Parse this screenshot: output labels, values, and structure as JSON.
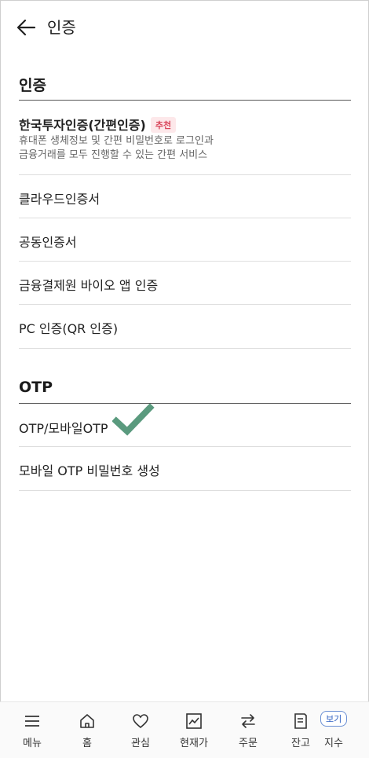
{
  "header": {
    "title": "인증"
  },
  "sections": {
    "auth": {
      "title": "인증",
      "items": [
        {
          "label": "한국투자인증(간편인증)",
          "badge": "추천",
          "desc_line1": "휴대폰 생체정보 및 간편 비밀번호로 로그인과",
          "desc_line2": "금융거래를 모두 진행할 수 있는 간편 서비스"
        },
        {
          "label": "클라우드인증서"
        },
        {
          "label": "공동인증서"
        },
        {
          "label": "금융결제원 바이오 앱 인증"
        },
        {
          "label": "PC 인증(QR 인증)"
        }
      ]
    },
    "otp": {
      "title": "OTP",
      "items": [
        {
          "label": "OTP/모바일OTP"
        },
        {
          "label": "모바일 OTP 비밀번호 생성"
        }
      ]
    }
  },
  "colors": {
    "accent_check": "#5a9a7e",
    "badge_bg": "#fde8ea",
    "badge_text": "#d9455a"
  },
  "bottom_nav": {
    "items": [
      {
        "label": "메뉴",
        "icon": "menu-icon"
      },
      {
        "label": "홈",
        "icon": "home-icon"
      },
      {
        "label": "관심",
        "icon": "heart-icon"
      },
      {
        "label": "현재가",
        "icon": "chart-icon"
      },
      {
        "label": "주문",
        "icon": "swap-icon"
      },
      {
        "label": "잔고",
        "icon": "document-icon"
      },
      {
        "label": "지수",
        "icon": "index-icon"
      }
    ],
    "bogi_label": "보기"
  }
}
